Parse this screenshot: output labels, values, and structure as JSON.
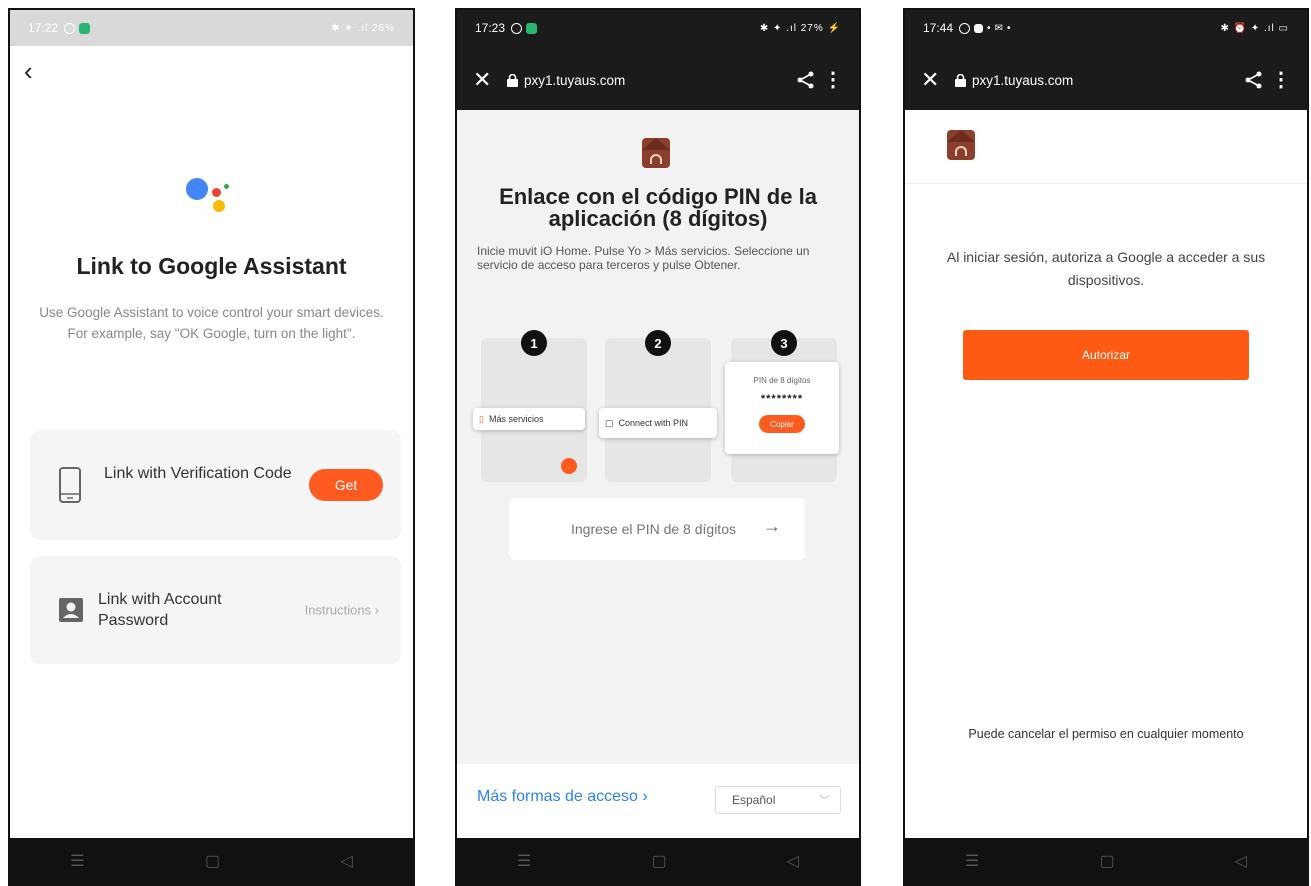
{
  "colors": {
    "accent": "#ff5a1f",
    "link": "#2f83e5",
    "dark_bar": "#1b1b1b"
  },
  "phone1": {
    "status": {
      "time": "17:22",
      "sys": "✱ ✦ .ıl 26%"
    },
    "title": "Link to Google Assistant",
    "description": "Use Google Assistant to voice control your smart devices. For example, say \"OK Google, turn on the light\".",
    "option1": {
      "label": "Link with Verification Code",
      "button": "Get",
      "icon": "phone-icon"
    },
    "option2": {
      "label": "Link with Account Password",
      "action": "Instructions ›",
      "icon": "account-icon"
    }
  },
  "phone2": {
    "status": {
      "time": "17:23",
      "sys": "✱ ✦ .ıl 27% ⚡"
    },
    "url": "pxy1.tuyaus.com",
    "title": "Enlace con el código PIN de la aplicación (8 dígitos)",
    "description": "Inicie muvit iO Home. Pulse Yo > Más servicios. Seleccione un servicio de acceso para terceros y pulse Obtener.",
    "steps": [
      {
        "num": "1",
        "label": "Más servicios"
      },
      {
        "num": "2",
        "label": "Connect with PIN"
      },
      {
        "num": "3",
        "pin_title": "PIN de 8 dígitos",
        "pin": "********",
        "copy": "Copiar"
      }
    ],
    "pin_placeholder": "Ingrese el PIN de 8 dígitos",
    "more_access": "Más formas de acceso ›",
    "language": "Español"
  },
  "phone3": {
    "status": {
      "time": "17:44",
      "sys": "✱ ⏰ ✦ .ıl ▭"
    },
    "url": "pxy1.tuyaus.com",
    "message": "Al iniciar sesión, autoriza a Google a acceder a sus dispositivos.",
    "authorize": "Autorizar",
    "cancel_note": "Puede cancelar el permiso en cualquier momento"
  },
  "nav": {
    "menu": "☰",
    "home": "▢",
    "back": "◁"
  }
}
